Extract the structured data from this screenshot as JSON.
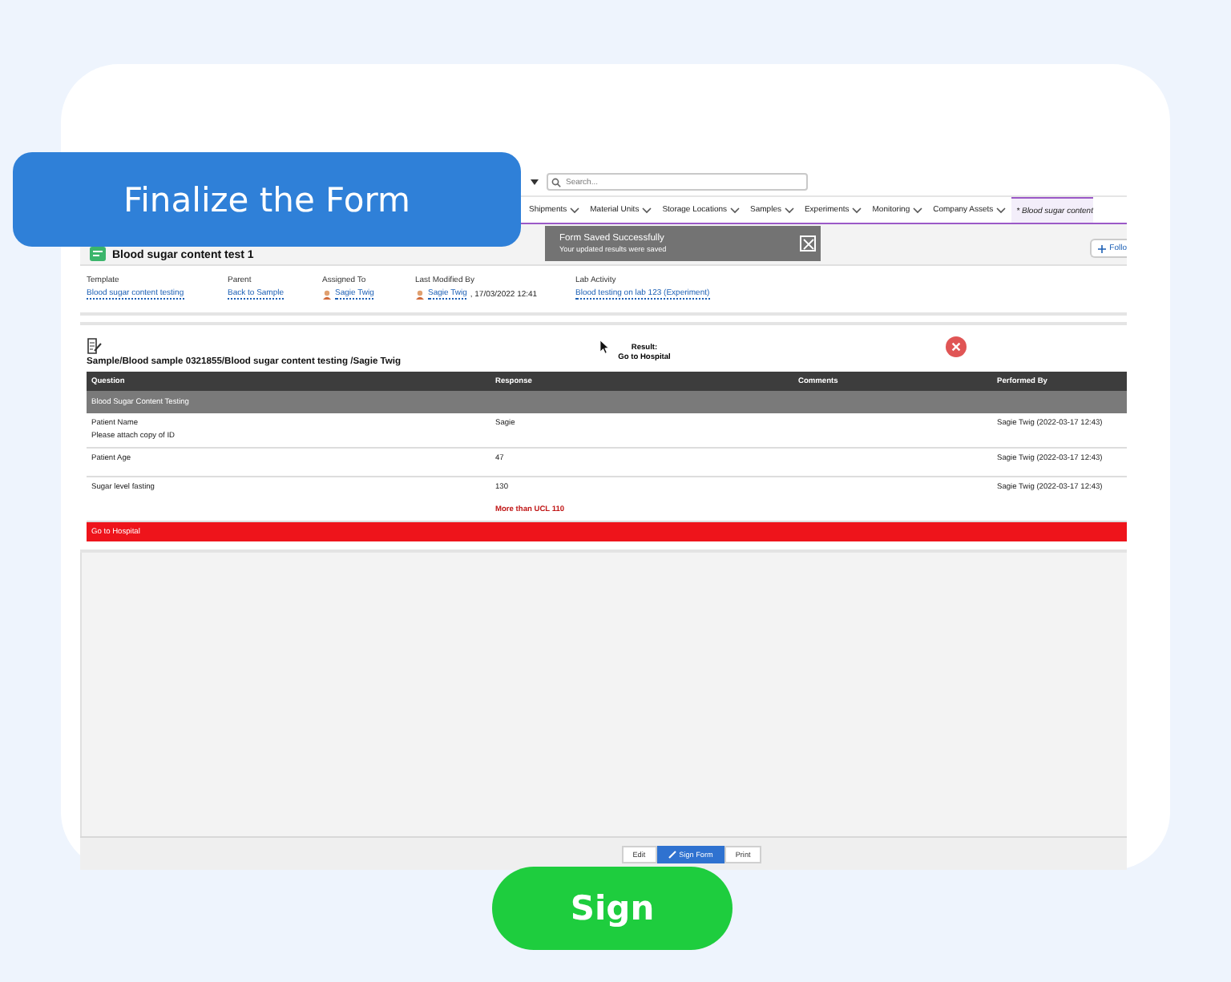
{
  "callout": {
    "title": "Finalize the Form"
  },
  "top_bar": {
    "search": {
      "placeholder": "Search..."
    }
  },
  "nav_tabs": [
    {
      "label": "Shipments",
      "selected": false
    },
    {
      "label": "Material Units",
      "selected": false
    },
    {
      "label": "Storage Locations",
      "selected": false
    },
    {
      "label": "Samples",
      "selected": false
    },
    {
      "label": "Experiments",
      "selected": false
    },
    {
      "label": "Monitoring",
      "selected": false
    },
    {
      "label": "Company Assets",
      "selected": false
    },
    {
      "label": "* Blood sugar content",
      "selected": true
    }
  ],
  "toast": {
    "title": "Form Saved Successfully",
    "message": "Your updated results were saved"
  },
  "record": {
    "title": "Blood sugar content test 1",
    "follow_button": "Follo",
    "fields": [
      {
        "label": "Template",
        "kind": "link",
        "value": "Blood sugar content testing"
      },
      {
        "label": "Parent",
        "kind": "link",
        "value": "Back to Sample"
      },
      {
        "label": "Assigned To",
        "kind": "user",
        "value": "Sagie Twig"
      },
      {
        "label": "Last Modified By",
        "kind": "user",
        "value": "Sagie Twig",
        "extra": ", 17/03/2022 12:41"
      },
      {
        "label": "Lab Activity",
        "kind": "link",
        "value": "Blood testing on lab 123 (Experiment)"
      }
    ]
  },
  "form": {
    "path": "Sample/Blood sample 0321855/Blood sugar content testing /Sagie Twig",
    "result_label": "Result:",
    "result": "Go to Hospital",
    "passed": false
  },
  "table": {
    "columns": [
      "Question",
      "Response",
      "Comments",
      "Performed By"
    ],
    "rows": [
      {
        "kind": "section",
        "label": "Blood Sugar Content Testing"
      },
      {
        "kind": "question",
        "question": "Patient Name",
        "note": "Please attach copy of ID",
        "response": "Sagie",
        "performed_by": "Sagie Twig (2022-03-17 12:43)"
      },
      {
        "kind": "question",
        "question": "Patient Age",
        "response": "47",
        "performed_by": "Sagie Twig (2022-03-17 12:43)"
      },
      {
        "kind": "question",
        "question": "Sugar level fasting",
        "response": "130",
        "warning": "More than UCL 110",
        "performed_by": "Sagie Twig (2022-03-17 12:43)"
      },
      {
        "kind": "alert",
        "label": "Go to Hospital"
      }
    ]
  },
  "actions": [
    {
      "label": "Edit",
      "primary": false
    },
    {
      "label": "Sign Form",
      "primary": true
    },
    {
      "label": "Print",
      "primary": false
    }
  ],
  "sign_button": {
    "label": "Sign"
  }
}
